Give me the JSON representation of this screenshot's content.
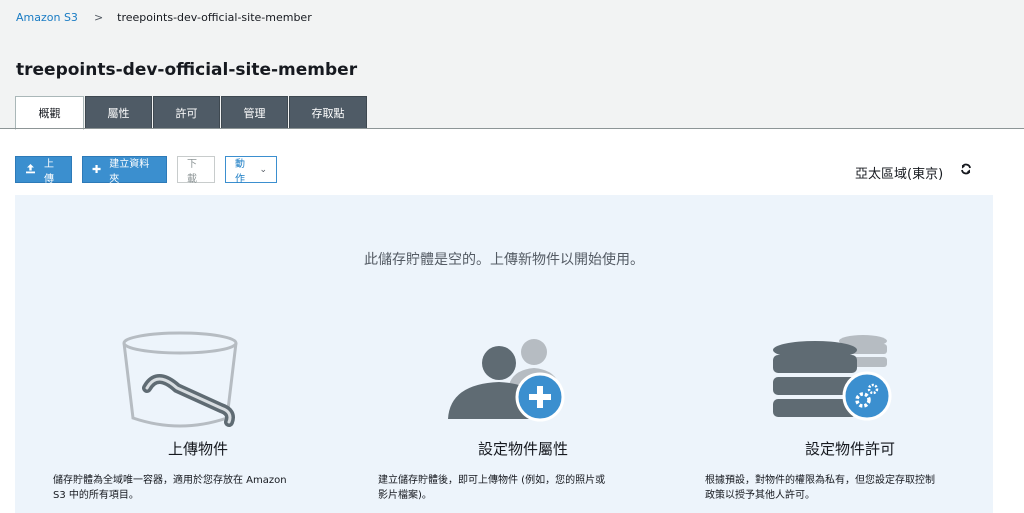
{
  "breadcrumb": {
    "root": "Amazon S3",
    "separator": ">",
    "current": "treepoints-dev-official-site-member"
  },
  "page_title": "treepoints-dev-official-site-member",
  "tabs": [
    {
      "label": "概觀",
      "active": true
    },
    {
      "label": "屬性",
      "active": false
    },
    {
      "label": "許可",
      "active": false
    },
    {
      "label": "管理",
      "active": false
    },
    {
      "label": "存取點",
      "active": false
    }
  ],
  "toolbar": {
    "upload_label": "上傳",
    "create_folder_label": "建立資料夾",
    "download_label": "下載",
    "actions_label": "動作"
  },
  "region": "亞太區域(東京)",
  "empty": {
    "message": "此儲存貯體是空的。上傳新物件以開始使用。",
    "features": [
      {
        "icon": "bucket-icon",
        "title": "上傳物件",
        "desc_line1": "儲存貯體為全域唯一容器，適用於您存放在 Amazon",
        "desc_line2": "S3 中的所有項目。"
      },
      {
        "icon": "users-add-icon",
        "title": "設定物件屬性",
        "desc_line1": "建立儲存貯體後，即可上傳物件 (例如，您的照片或",
        "desc_line2": "影片檔案)。"
      },
      {
        "icon": "database-settings-icon",
        "title": "設定物件許可",
        "desc_line1": "根據預設，對物件的權限為私有，但您設定存取控制",
        "desc_line2": "政策以授予其他人許可。"
      }
    ]
  },
  "colors": {
    "accent": "#3b8fcf",
    "tab_bg": "#4f5b66",
    "panel_bg": "#edf4fb"
  }
}
